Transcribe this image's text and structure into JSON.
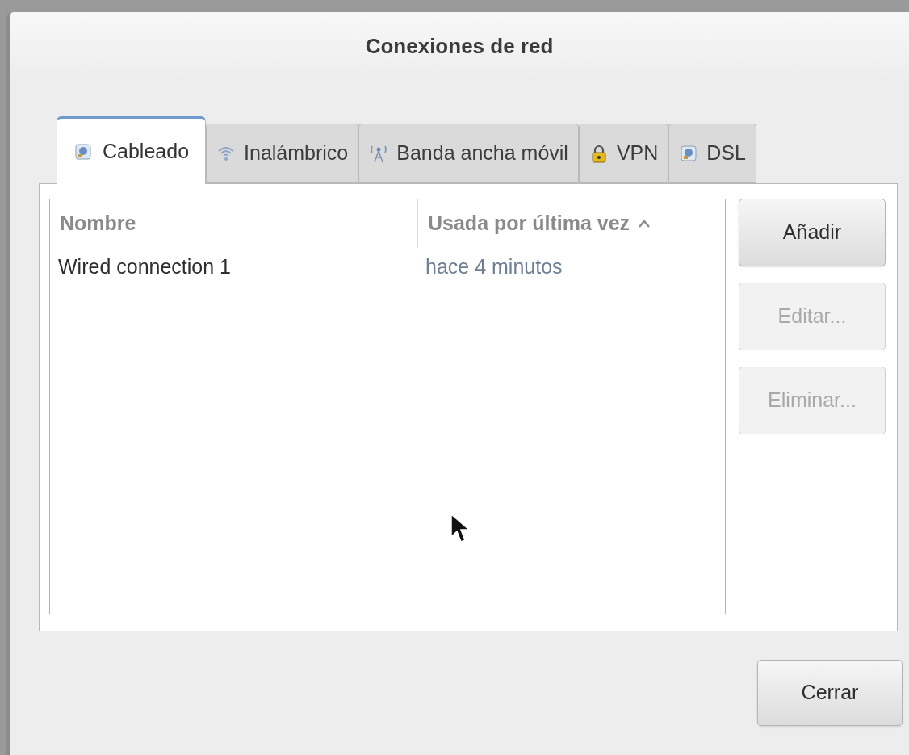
{
  "window": {
    "title": "Conexiones de red"
  },
  "tabs": [
    {
      "label": "Cableado",
      "kind": "wired",
      "selected": true
    },
    {
      "label": "Inalámbrico",
      "kind": "wireless",
      "selected": false
    },
    {
      "label": "Banda ancha móvil",
      "kind": "mobile",
      "selected": false
    },
    {
      "label": "VPN",
      "kind": "vpn",
      "selected": false
    },
    {
      "label": "DSL",
      "kind": "dsl",
      "selected": false
    }
  ],
  "table": {
    "columns": [
      {
        "label": "Nombre",
        "sorted": false
      },
      {
        "label": "Usada por última vez",
        "sorted": true
      }
    ],
    "rows": [
      {
        "cells": [
          "Wired connection 1",
          "hace 4 minutos"
        ]
      }
    ]
  },
  "side_buttons": [
    {
      "label": "Añadir",
      "disabled": false
    },
    {
      "label": "Editar...",
      "disabled": true
    },
    {
      "label": "Eliminar...",
      "disabled": true
    }
  ],
  "close_button": {
    "label": "Cerrar"
  }
}
